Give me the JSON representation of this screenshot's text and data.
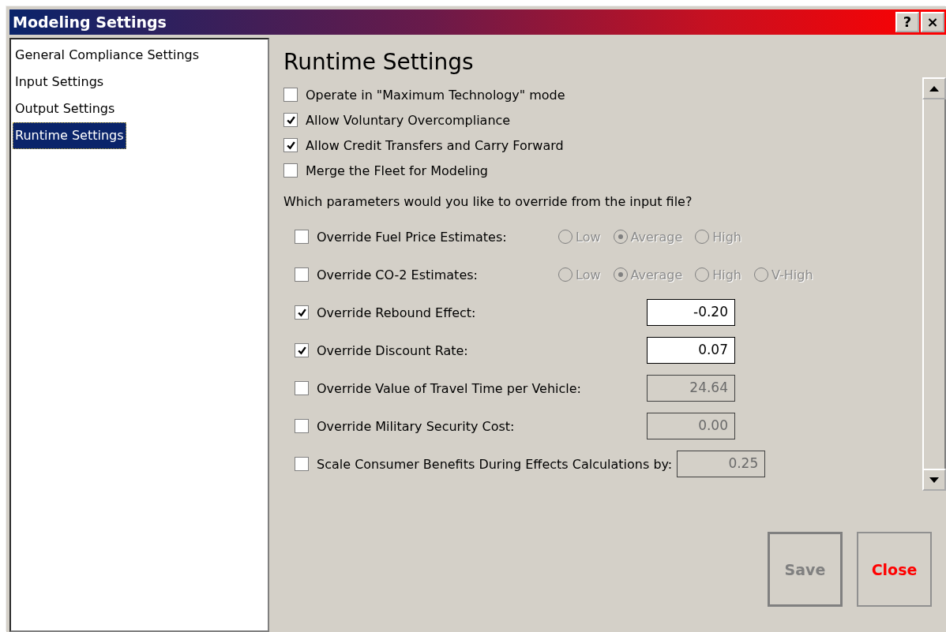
{
  "window": {
    "title": "Modeling Settings",
    "buttons": [
      "?",
      "×"
    ]
  },
  "sidebar": {
    "items": [
      {
        "label": "General Compliance Settings",
        "selected": false
      },
      {
        "label": "Input Settings",
        "selected": false
      },
      {
        "label": "Output Settings",
        "selected": false
      },
      {
        "label": "Runtime Settings",
        "selected": true
      }
    ]
  },
  "heading": "Runtime Settings",
  "options": [
    {
      "label": "Operate in \"Maximum Technology\" mode",
      "checked": false
    },
    {
      "label": "Allow Voluntary Overcompliance",
      "checked": true
    },
    {
      "label": "Allow Credit Transfers and Carry Forward",
      "checked": true
    },
    {
      "label": "Merge the Fleet for Modeling",
      "checked": false
    }
  ],
  "override_question": "Which parameters would you like to override from the input file?",
  "overrides": [
    {
      "kind": "radio",
      "label": "Override Fuel Price Estimates:",
      "checked": false,
      "disabled": true,
      "options": [
        {
          "label": "Low",
          "selected": false
        },
        {
          "label": "Average",
          "selected": true
        },
        {
          "label": "High",
          "selected": false
        }
      ]
    },
    {
      "kind": "radio",
      "label": "Override CO-2 Estimates:",
      "checked": false,
      "disabled": true,
      "options": [
        {
          "label": "Low",
          "selected": false
        },
        {
          "label": "Average",
          "selected": true
        },
        {
          "label": "High",
          "selected": false
        },
        {
          "label": "V-High",
          "selected": false
        }
      ]
    },
    {
      "kind": "field",
      "label": "Override Rebound Effect:",
      "checked": true,
      "disabled": false,
      "value": "-0.20"
    },
    {
      "kind": "field",
      "label": "Override Discount Rate:",
      "checked": true,
      "disabled": false,
      "value": "0.07"
    },
    {
      "kind": "field",
      "label": "Override Value of Travel Time per Vehicle:",
      "checked": false,
      "disabled": true,
      "value": "24.64"
    },
    {
      "kind": "field",
      "label": "Override Military Security Cost:",
      "checked": false,
      "disabled": true,
      "value": "0.00"
    },
    {
      "kind": "field",
      "label": "Scale Consumer Benefits During Effects Calculations by:",
      "checked": false,
      "disabled": true,
      "value": "0.25"
    }
  ],
  "buttons": [
    {
      "label": "Save",
      "disabled": true
    },
    {
      "label": "Close",
      "disabled": false
    }
  ]
}
